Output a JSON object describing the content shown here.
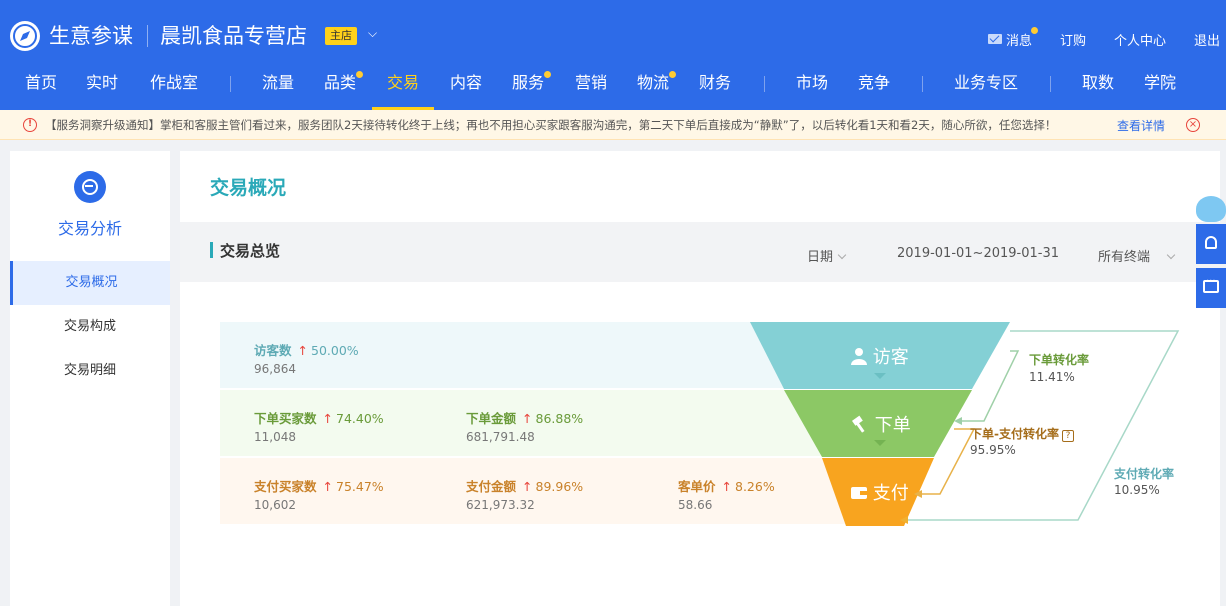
{
  "header": {
    "brand": "生意参谋",
    "shop_name": "晨凯食品专营店",
    "shop_badge": "主店",
    "shop_caret": "⌵",
    "links": {
      "messages": "消息",
      "orders": "订购",
      "personal_center": "个人中心",
      "logout": "退出"
    }
  },
  "nav": {
    "items": [
      {
        "label": "首页"
      },
      {
        "label": "实时"
      },
      {
        "label": "作战室"
      },
      {
        "label": "流量"
      },
      {
        "label": "品类"
      },
      {
        "label": "交易"
      },
      {
        "label": "内容"
      },
      {
        "label": "服务"
      },
      {
        "label": "营销"
      },
      {
        "label": "物流"
      },
      {
        "label": "财务"
      },
      {
        "label": "市场"
      },
      {
        "label": "竞争"
      },
      {
        "label": "业务专区"
      },
      {
        "label": "取数"
      },
      {
        "label": "学院"
      }
    ],
    "active": "交易"
  },
  "notice": {
    "icon": "!",
    "text": "【服务洞察升级通知】掌柜和客服主管们看过来，服务团队2天接待转化终于上线；再也不用担心买家跟客服沟通完，第二天下单后直接成为“静默”了，以后转化看1天和看2天，随心所欲，任您选择！",
    "link": "查看详情",
    "close": "×"
  },
  "sidebar": {
    "title": "交易分析",
    "items": [
      {
        "label": "交易概况"
      },
      {
        "label": "交易构成"
      },
      {
        "label": "交易明细"
      }
    ]
  },
  "main": {
    "page_title": "交易概况",
    "section_title": "交易总览",
    "date_label": "日期",
    "date_range": "2019-01-01~2019-01-31",
    "terminal": "所有终端",
    "up_arrow": "↑",
    "rows": {
      "visitors": {
        "label": "访客数",
        "change": "50.00%",
        "value": "96,864"
      },
      "order_buyers": {
        "label": "下单买家数",
        "change": "74.40%",
        "value": "11,048"
      },
      "order_amount": {
        "label": "下单金额",
        "change": "86.88%",
        "value": "681,791.48"
      },
      "pay_buyers": {
        "label": "支付买家数",
        "change": "75.47%",
        "value": "10,602"
      },
      "pay_amount": {
        "label": "支付金额",
        "change": "89.96%",
        "value": "621,973.32"
      },
      "avg_price": {
        "label": "客单价",
        "change": "8.26%",
        "value": "58.66"
      }
    },
    "funnel": {
      "stage_visit": "访客",
      "stage_order": "下单",
      "stage_pay": "支付",
      "order_rate_label": "下单转化率",
      "order_rate_value": "11.41%",
      "order_pay_rate_label": "下单-支付转化率",
      "order_pay_rate_value": "95.95%",
      "pay_rate_label": "支付转化率",
      "pay_rate_value": "10.95%",
      "help": "?"
    }
  },
  "colors": {
    "primary": "#2d6be8",
    "accent_yellow": "#ffd11a",
    "teal": "#84d0d5",
    "green": "#8cc865",
    "orange": "#f8a41f"
  }
}
